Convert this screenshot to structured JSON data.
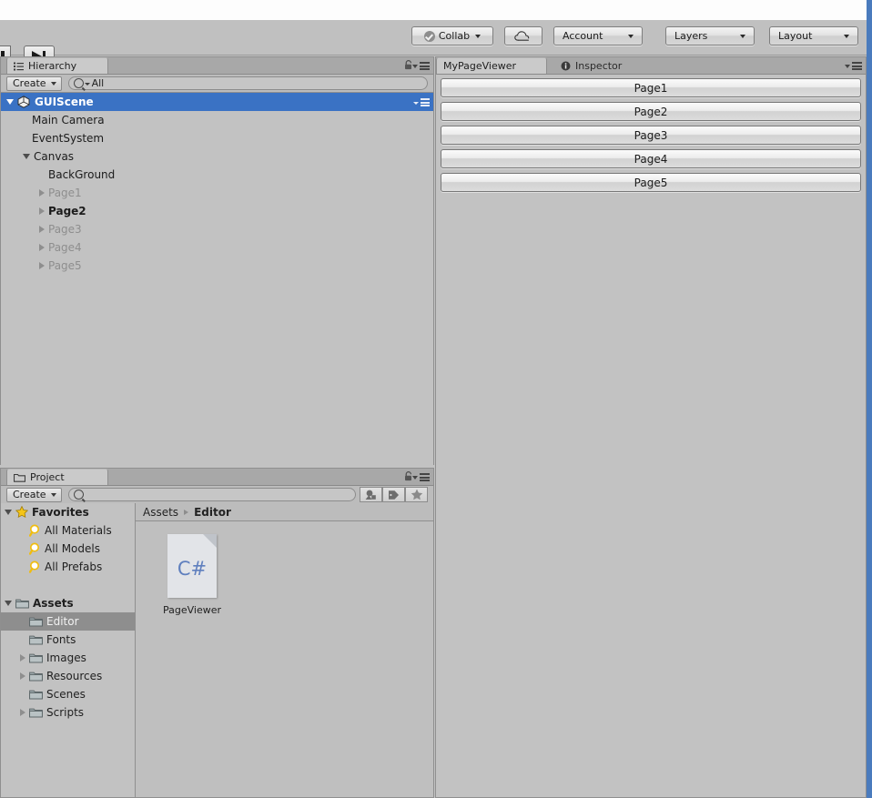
{
  "app": {
    "accent_color": "#4a7bbd",
    "selection_color": "#3a72c4",
    "panel_bg": "#c2c2c2"
  },
  "toolbar": {
    "pause_label": "Pause",
    "step_label": "Step",
    "collab_label": "Collab",
    "cloud_label": "Cloud Services",
    "account_label": "Account",
    "layers_label": "Layers",
    "layout_label": "Layout"
  },
  "hierarchy": {
    "tab_label": "Hierarchy",
    "create_label": "Create",
    "search_value": "All",
    "search_placeholder": "All",
    "rows": [
      {
        "label": "GUIScene",
        "depth": 0,
        "arrow": "down",
        "icon": "unity-scene-icon",
        "selected": true,
        "dim": false,
        "bold": true
      },
      {
        "label": "Main Camera",
        "depth": 1,
        "arrow": "none",
        "icon": "none",
        "selected": false,
        "dim": false,
        "bold": false
      },
      {
        "label": "EventSystem",
        "depth": 1,
        "arrow": "none",
        "icon": "none",
        "selected": false,
        "dim": false,
        "bold": false
      },
      {
        "label": "Canvas",
        "depth": 1,
        "arrow": "down",
        "icon": "none",
        "selected": false,
        "dim": false,
        "bold": false
      },
      {
        "label": "BackGround",
        "depth": 2,
        "arrow": "none",
        "icon": "none",
        "selected": false,
        "dim": false,
        "bold": false
      },
      {
        "label": "Page1",
        "depth": 2,
        "arrow": "right",
        "icon": "none",
        "selected": false,
        "dim": true,
        "bold": false
      },
      {
        "label": "Page2",
        "depth": 2,
        "arrow": "right",
        "icon": "none",
        "selected": false,
        "dim": false,
        "bold": true
      },
      {
        "label": "Page3",
        "depth": 2,
        "arrow": "right",
        "icon": "none",
        "selected": false,
        "dim": true,
        "bold": false
      },
      {
        "label": "Page4",
        "depth": 2,
        "arrow": "right",
        "icon": "none",
        "selected": false,
        "dim": true,
        "bold": false
      },
      {
        "label": "Page5",
        "depth": 2,
        "arrow": "right",
        "icon": "none",
        "selected": false,
        "dim": true,
        "bold": false
      }
    ]
  },
  "project": {
    "tab_label": "Project",
    "create_label": "Create",
    "search_value": "",
    "search_placeholder": "",
    "breadcrumb": {
      "root": "Assets",
      "current": "Editor"
    },
    "tree": [
      {
        "label": "Favorites",
        "depth": 0,
        "arrow": "down",
        "icon": "star-icon",
        "bold": true,
        "selected": false
      },
      {
        "label": "All Materials",
        "depth": 1,
        "arrow": "none",
        "icon": "search-icon",
        "bold": false,
        "selected": false
      },
      {
        "label": "All Models",
        "depth": 1,
        "arrow": "none",
        "icon": "search-icon",
        "bold": false,
        "selected": false
      },
      {
        "label": "All Prefabs",
        "depth": 1,
        "arrow": "none",
        "icon": "search-icon",
        "bold": false,
        "selected": false
      },
      {
        "label": "",
        "depth": 0,
        "arrow": "none",
        "icon": "none",
        "bold": false,
        "selected": false
      },
      {
        "label": "Assets",
        "depth": 0,
        "arrow": "down",
        "icon": "folder-icon",
        "bold": true,
        "selected": false
      },
      {
        "label": "Editor",
        "depth": 1,
        "arrow": "none",
        "icon": "folder-icon",
        "bold": false,
        "selected": true
      },
      {
        "label": "Fonts",
        "depth": 1,
        "arrow": "none",
        "icon": "folder-icon",
        "bold": false,
        "selected": false
      },
      {
        "label": "Images",
        "depth": 1,
        "arrow": "right",
        "icon": "folder-icon",
        "bold": false,
        "selected": false
      },
      {
        "label": "Resources",
        "depth": 1,
        "arrow": "right",
        "icon": "folder-icon",
        "bold": false,
        "selected": false
      },
      {
        "label": "Scenes",
        "depth": 1,
        "arrow": "none",
        "icon": "folder-icon",
        "bold": false,
        "selected": false
      },
      {
        "label": "Scripts",
        "depth": 1,
        "arrow": "right",
        "icon": "folder-icon",
        "bold": false,
        "selected": false
      }
    ],
    "assets": [
      {
        "name": "PageViewer",
        "type": "csharp-script",
        "badge": "C#"
      }
    ],
    "toolbar_icons": [
      "asset-filter-icon",
      "label-filter-icon",
      "favorite-filter-icon"
    ]
  },
  "viewer": {
    "tabs": [
      {
        "label": "MyPageViewer",
        "active": true,
        "icon": "none"
      },
      {
        "label": "Inspector",
        "active": false,
        "icon": "info-icon"
      }
    ],
    "buttons": [
      {
        "label": "Page1"
      },
      {
        "label": "Page2"
      },
      {
        "label": "Page3"
      },
      {
        "label": "Page4"
      },
      {
        "label": "Page5"
      }
    ]
  }
}
